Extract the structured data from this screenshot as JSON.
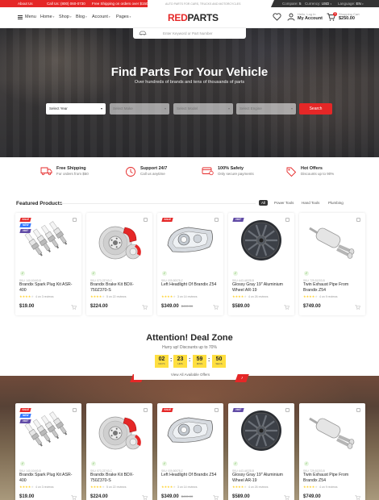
{
  "topbar": {
    "about": "About Us",
    "call": "Call Us: (800) 060-0730",
    "shipping": "Free Shipping on orders over $150",
    "tagline": "AUTO PARTS FOR CARS, TRUCKS AND MOTORCYCLES",
    "compare_label": "Compare:",
    "compare_count": "5",
    "currency_label": "Currency:",
    "currency": "USD",
    "language_label": "Language:",
    "language": "EN"
  },
  "header": {
    "menu": "Menu",
    "nav": [
      "Home",
      "Shop",
      "Blog",
      "Account",
      "Pages"
    ],
    "logo_red": "RED",
    "logo_dark": "PARTS",
    "login_small": "Hello, Log In",
    "login_big": "My Account",
    "cart_count": "3",
    "cart_small": "Shopping Cart",
    "cart_total": "$250.00"
  },
  "hero": {
    "search_placeholder": "Enter Keyword or Part Number",
    "title": "Find Parts For Your Vehicle",
    "subtitle": "Over hundreds of brands and tens of thousands of parts",
    "selects": [
      "Select Year",
      "Select Make",
      "Select Model",
      "Select Engine"
    ],
    "button": "Search"
  },
  "features": [
    {
      "icon": "truck-icon",
      "title": "Free Shipping",
      "desc": "For orders from $50"
    },
    {
      "icon": "support-icon",
      "title": "Support 24/7",
      "desc": "Call us anytime"
    },
    {
      "icon": "safety-icon",
      "title": "100% Safety",
      "desc": "Only secure payments"
    },
    {
      "icon": "tag-icon",
      "title": "Hot Offers",
      "desc": "Discounts up to 90%"
    }
  ],
  "featured": {
    "title": "Featured Products",
    "tabs": [
      "All",
      "Power Tools",
      "Hand Tools",
      "Plumbing"
    ]
  },
  "products": [
    {
      "sku": "SKU: 140-10440-B",
      "name": "Brandix Spark Plug Kit ASR-400",
      "reviews": "4 on 3 reviews",
      "price": "$19.00",
      "old": "",
      "badges": [
        "SALE",
        "NEW",
        "HOT"
      ]
    },
    {
      "sku": "SKU: 573-23743-C",
      "name": "Brandix Brake Kit BDX-750Z370-S",
      "reviews": "5 on 22 reviews",
      "price": "$224.00",
      "old": "",
      "badges": []
    },
    {
      "sku": "SKU: 009-50078-Z",
      "name": "Left Headlight Of Brandix Z54",
      "reviews": "3 on 14 reviews",
      "price": "$349.00",
      "old": "$415.00",
      "badges": [
        "SALE"
      ]
    },
    {
      "sku": "SKU: A43-44328-B",
      "name": "Glossy Gray 19\" Aluminium Wheel AR-19",
      "reviews": "4 on 26 reviews",
      "price": "$589.00",
      "old": "",
      "badges": [
        "HOT"
      ]
    },
    {
      "sku": "SKU: 729-51203-B",
      "name": "Twin Exhaust Pipe From Brandix Z54",
      "reviews": "4 on 9 reviews",
      "price": "$749.00",
      "old": "",
      "badges": []
    }
  ],
  "deal": {
    "title": "Attention! Deal Zone",
    "subtitle": "Hurry up! Discounts up to 70%",
    "timer": [
      {
        "n": "02",
        "u": "DAYS"
      },
      {
        "n": "23",
        "u": "HRS"
      },
      {
        "n": "59",
        "u": "MINS"
      },
      {
        "n": "50",
        "u": "SECS"
      }
    ],
    "view_all": "View All Available Offers"
  },
  "deal_products": [
    {
      "sku": "SKU: 140-10440-B",
      "name": "Brandix Spark Plug Kit ASR-400",
      "reviews": "4 on 3 reviews",
      "price": "$19.00",
      "old": "",
      "badges": [
        "SALE",
        "NEW",
        "HOT"
      ]
    },
    {
      "sku": "SKU: 573-23743-C",
      "name": "Brandix Brake Kit BDX-750Z370-S",
      "reviews": "5 on 22 reviews",
      "price": "$224.00",
      "old": "",
      "badges": []
    },
    {
      "sku": "SKU: 009-50078-Z",
      "name": "Left Headlight Of Brandix Z54",
      "reviews": "3 on 14 reviews",
      "price": "$349.00",
      "old": "$415.00",
      "badges": [
        "SALE"
      ]
    },
    {
      "sku": "SKU: A43-44328-B",
      "name": "Glossy Gray 19\" Aluminium Wheel AR-19",
      "reviews": "4 on 26 reviews",
      "price": "$589.00",
      "old": "",
      "badges": [
        "HOT"
      ]
    },
    {
      "sku": "SKU: 729-51203-B",
      "name": "Twin Exhaust Pipe From Brandix Z54",
      "reviews": "4 on 9 reviews",
      "price": "$749.00",
      "old": "",
      "badges": []
    }
  ],
  "colors": {
    "accent": "#e52727",
    "dark": "#333333",
    "timer": "#ffdf40",
    "rating": "#ffd333"
  }
}
